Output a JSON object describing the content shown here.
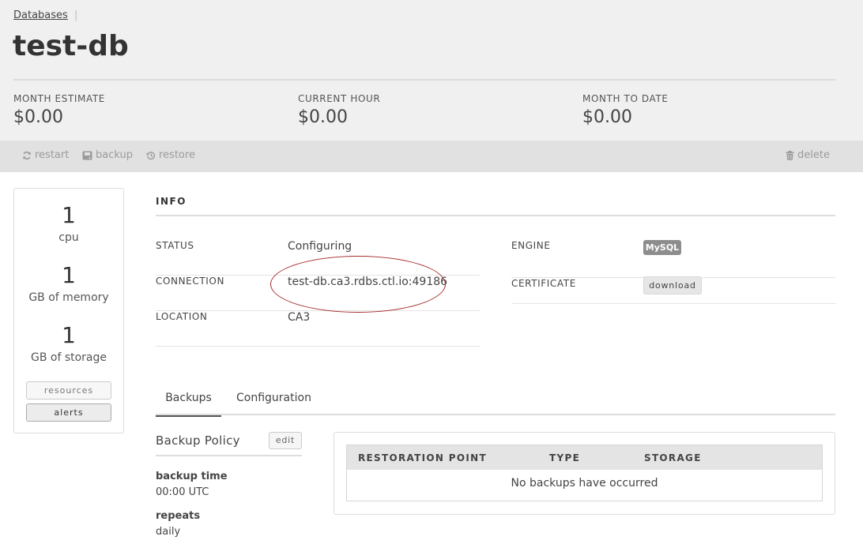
{
  "breadcrumb": {
    "parent": "Databases",
    "separator": "|"
  },
  "page_title": "test-db",
  "costs": [
    {
      "label": "MONTH ESTIMATE",
      "value": "$0.00"
    },
    {
      "label": "CURRENT HOUR",
      "value": "$0.00"
    },
    {
      "label": "MONTH TO DATE",
      "value": "$0.00"
    }
  ],
  "toolbar": {
    "restart": {
      "label": "restart",
      "icon": "refresh-icon"
    },
    "backup": {
      "label": "backup",
      "icon": "disk-icon"
    },
    "restore": {
      "label": "restore",
      "icon": "history-icon"
    },
    "delete": {
      "label": "delete",
      "icon": "trash-icon"
    }
  },
  "resources": {
    "cpu": {
      "value": "1",
      "unit": "cpu"
    },
    "memory": {
      "value": "1",
      "unit": "GB of memory"
    },
    "storage": {
      "value": "1",
      "unit": "GB of storage"
    },
    "resources_button": "resources",
    "alerts_button": "alerts"
  },
  "info": {
    "heading": "INFO",
    "status": {
      "label": "STATUS",
      "value": "Configuring"
    },
    "connection": {
      "label": "CONNECTION",
      "value": "test-db.ca3.rdbs.ctl.io:49186"
    },
    "location": {
      "label": "LOCATION",
      "value": "CA3"
    },
    "engine": {
      "label": "ENGINE",
      "value": "MySQL"
    },
    "certificate": {
      "label": "CERTIFICATE",
      "value": "download"
    }
  },
  "tabs": {
    "backups": "Backups",
    "configuration": "Configuration"
  },
  "backup_policy": {
    "title": "Backup Policy",
    "edit": "edit",
    "backup_time_label": "backup time",
    "backup_time_value": "00:00 UTC",
    "repeats_label": "repeats",
    "repeats_value": "daily"
  },
  "backups_table": {
    "columns": [
      "RESTORATION POINT",
      "TYPE",
      "STORAGE"
    ],
    "empty_message": "No backups have occurred"
  },
  "colors": {
    "annotation_oval": "#a72a2a",
    "engine_badge": "#8d8d8d"
  }
}
